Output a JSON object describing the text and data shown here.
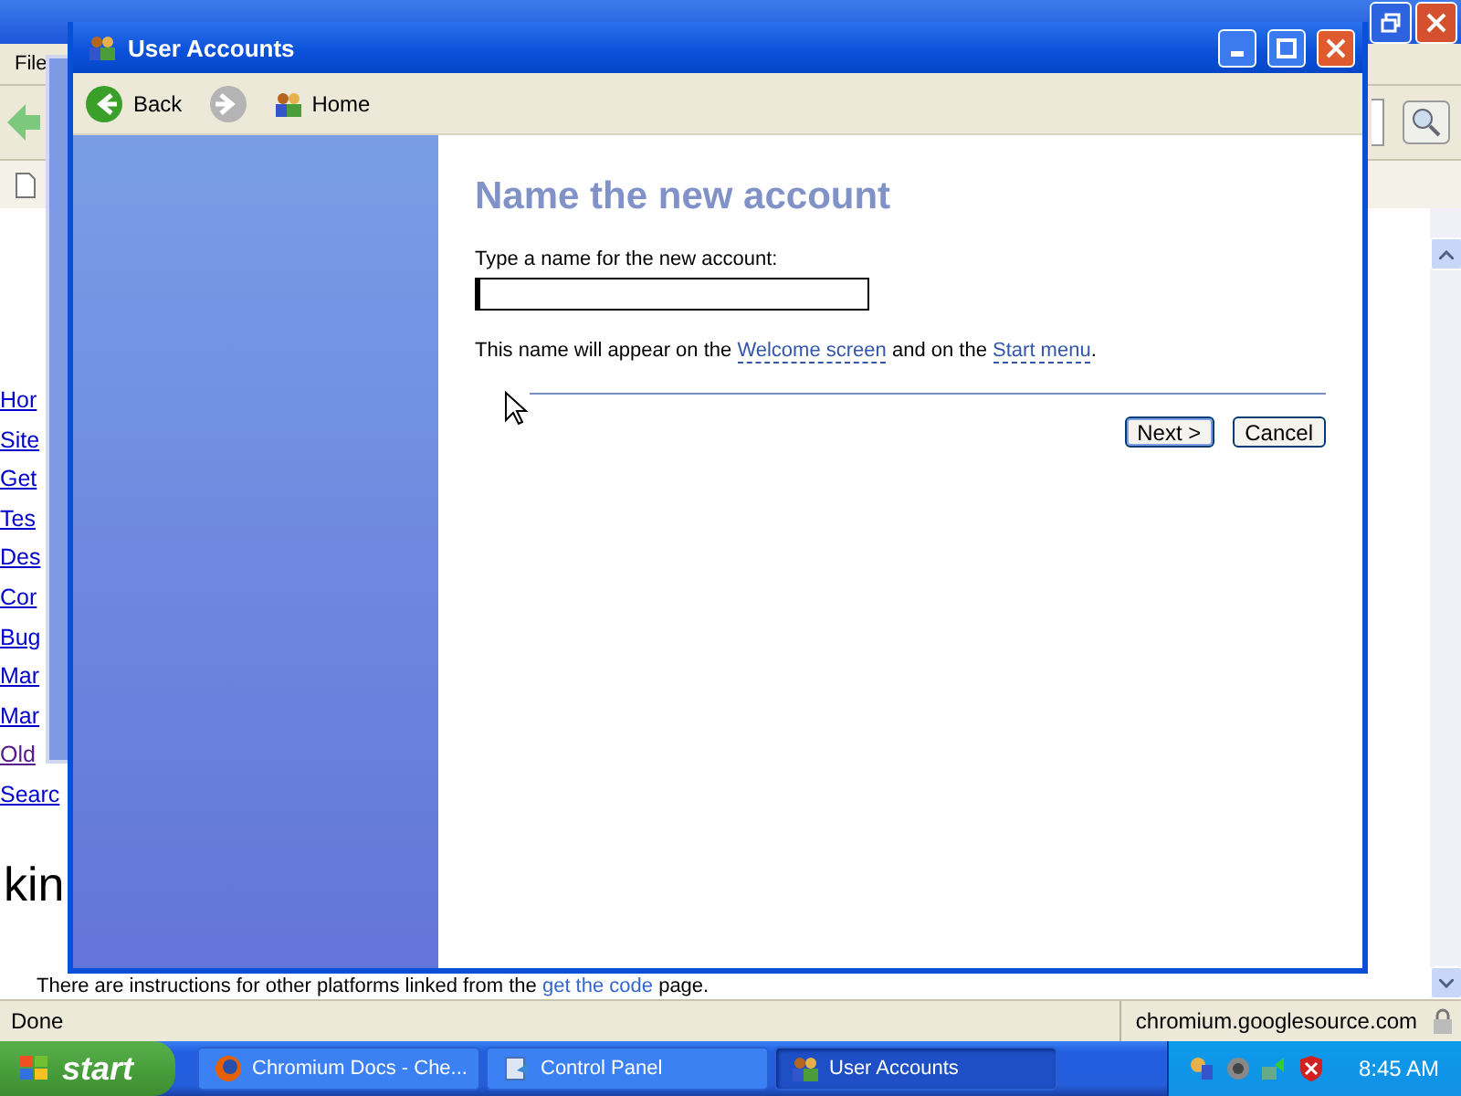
{
  "browser": {
    "menu": [
      "File"
    ],
    "links": [
      {
        "label": "Hor",
        "visited": false
      },
      {
        "label": "Site",
        "visited": false
      },
      {
        "label": "Get",
        "visited": false
      },
      {
        "label": "Tes",
        "visited": false
      },
      {
        "label": "Des",
        "visited": false
      },
      {
        "label": "Cor",
        "visited": false
      },
      {
        "label": "Bug",
        "visited": false
      },
      {
        "label": "Mar",
        "visited": false
      },
      {
        "label": "Mar",
        "visited": false
      },
      {
        "label": "Old",
        "visited": true
      },
      {
        "label": "Searc",
        "visited": false
      }
    ],
    "heading": "kin",
    "paragraph": [
      {
        "kind": "text",
        "text": "There are instructions for other platforms linked from the "
      },
      {
        "kind": "link",
        "text": "get the code"
      },
      {
        "kind": "text",
        "text": " page."
      }
    ],
    "status_bar": {
      "text": "Done",
      "url": "chromium.googlesource.com"
    }
  },
  "dialog": {
    "title": "User Accounts",
    "toolbar": [
      {
        "kind": "back",
        "label": "Back",
        "disabled": false
      },
      {
        "kind": "forward",
        "disabled": true
      },
      {
        "kind": "home",
        "label": "Home",
        "disabled": false
      }
    ],
    "heading": "Name the new account",
    "prompt": "Type a name for the new account:",
    "note": [
      {
        "kind": "text",
        "text": "This name will appear on the "
      },
      {
        "kind": "link",
        "text": "Welcome screen"
      },
      {
        "kind": "text",
        "text": " and on the "
      },
      {
        "kind": "link",
        "text": "Start menu"
      },
      {
        "kind": "text",
        "text": "."
      }
    ],
    "buttons": [
      {
        "label": "Next >",
        "default": true
      },
      {
        "label": "Cancel",
        "default": false
      }
    ]
  },
  "taskbar": {
    "start": "start",
    "tasks": [
      {
        "kind": "firefox",
        "label": "Chromium Docs - Che...",
        "selected": false
      },
      {
        "kind": "control",
        "label": "Control Panel",
        "selected": false
      },
      {
        "kind": "users",
        "label": "User Accounts",
        "selected": true
      }
    ],
    "clock": "8:45 AM"
  }
}
